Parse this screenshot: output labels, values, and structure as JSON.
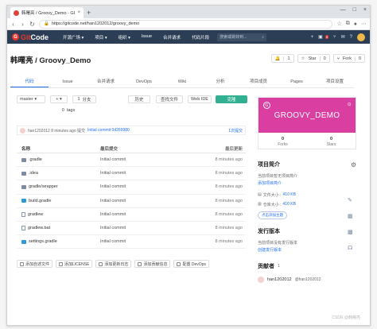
{
  "browser": {
    "tab_title": "韩曙亮 / Groovy_Demo - GIT",
    "url": "https://gitcode.net/han1202012/groovy_demo"
  },
  "site": {
    "logo_text_a": "Git",
    "logo_text_b": "Code",
    "nav": [
      "开源广场 ▾",
      "项目 ▾",
      "组织 ▾",
      "Issue",
      "合并请求",
      "代码片段"
    ],
    "search_placeholder": "搜索或跳转到...",
    "badge": "3"
  },
  "repo": {
    "title": "韩曙亮 / Groovy_Demo",
    "watch_label": "",
    "watch_count": "1",
    "star_label": "Star",
    "star_count": "0",
    "fork_label": "Fork",
    "fork_count": "0"
  },
  "tabs": [
    "代码",
    "Issue",
    "合并请求",
    "DevOps",
    "Wiki",
    "分析",
    "项目成员",
    "Pages",
    "项目设置"
  ],
  "toolbar": {
    "branch": "master ▾",
    "plus": "+ ▾",
    "branches": "分支",
    "history": "历史",
    "find_file": "查找文件",
    "web_ide": "Web IDE",
    "clone": "克隆",
    "tags": "tags",
    "branches_count": "1",
    "tags_count": "0"
  },
  "commit": {
    "text": "han1202012 8 minutes ago 提交",
    "link": "Initial commit 0d269980",
    "count": "1次提交"
  },
  "table": {
    "headers": [
      "名称",
      "最后提交",
      "最后更新"
    ],
    "rows": [
      {
        "name": ".gradle",
        "type": "folder",
        "commit": "Initial commit",
        "time": "8 minutes ago"
      },
      {
        "name": ".idea",
        "type": "folder",
        "commit": "Initial commit",
        "time": "8 minutes ago"
      },
      {
        "name": "gradle/wrapper",
        "type": "folder",
        "commit": "Initial commit",
        "time": "8 minutes ago"
      },
      {
        "name": "build.gradle",
        "type": "gradle",
        "commit": "Initial commit",
        "time": "8 minutes ago"
      },
      {
        "name": "gradlew",
        "type": "file",
        "commit": "Initial commit",
        "time": "8 minutes ago"
      },
      {
        "name": "gradlew.bat",
        "type": "file",
        "commit": "Initial commit",
        "time": "8 minutes ago"
      },
      {
        "name": "settings.gradle",
        "type": "gradle",
        "commit": "Initial commit",
        "time": "8 minutes ago"
      }
    ]
  },
  "bottom_buttons": [
    "添加自述文件",
    "添加LICENSE",
    "添加更新日志",
    "添加贡献信息",
    "配置 DevOps"
  ],
  "side": {
    "banner_title": "GROOVY_DEMO",
    "banner_letter": "G",
    "forks_label": "Forks",
    "forks_count": "0",
    "stars_label": "Stars",
    "stars_count": "0",
    "intro_title": "项目简介",
    "intro_empty": "当前项目暂无项目简介",
    "intro_link": "添加项目简介",
    "file_label": "文件大小 :",
    "file_size": "410 KB",
    "repo_label": "仓库大小 :",
    "repo_size": "410 KB",
    "add_topic": "点击添加主题",
    "release_title": "发行版本",
    "release_empty": "当前项目没有发行版本",
    "release_link": "创建发行版本",
    "contrib_title": "贡献者",
    "contrib_count": "1",
    "contrib_name": "han1202012",
    "contrib_handle": "@han1202012"
  },
  "watermark": "CSDN @韩曙亮"
}
